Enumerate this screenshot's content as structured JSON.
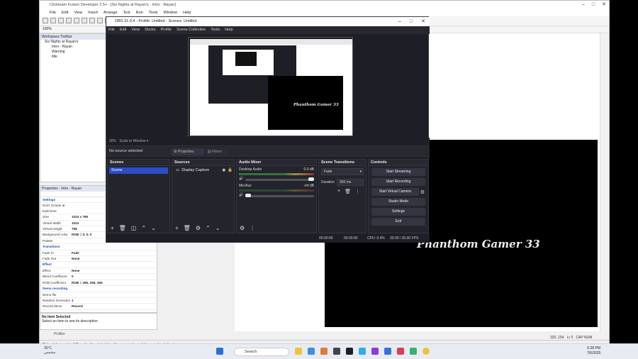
{
  "ctf": {
    "title": "Clickteam Fusion Developer 2.5+ - [Six Nights at Rayan's - Intro - Rayan]",
    "menu": [
      "File",
      "Edit",
      "View",
      "Insert",
      "Arrange",
      "Text",
      "Run",
      "Tools",
      "Window",
      "Help"
    ],
    "zoom": "100%",
    "workspace": {
      "title": "Workspace Toolbar",
      "tree": [
        "Six Nights at Rayan's",
        "Intro - Rayan",
        "Warning",
        "title"
      ]
    },
    "properties": {
      "title": "Properties - Intro - Rayan",
      "rows": [
        {
          "k": "Settings",
          "v": "",
          "sec": true
        },
        {
          "k": "Don't include at build time",
          "v": ""
        },
        {
          "k": "Size",
          "v": "1024 x 768"
        },
        {
          "k": "Virtual Width",
          "v": "1024"
        },
        {
          "k": "Virtual Height",
          "v": "768"
        },
        {
          "k": "Background color",
          "v": "RGB = 0, 0, 0"
        },
        {
          "k": "Palette",
          "v": ""
        },
        {
          "k": "Transitions",
          "v": "",
          "sec": true
        },
        {
          "k": "Fade In",
          "v": "Fade"
        },
        {
          "k": "Fade Out",
          "v": "None"
        },
        {
          "k": "Effect",
          "v": "",
          "sec": true
        },
        {
          "k": "Effect",
          "v": "None"
        },
        {
          "k": "Blend Coefficient",
          "v": "0"
        },
        {
          "k": "RGB Coefficient",
          "v": "RGB = 255, 255, 255"
        },
        {
          "k": "Demo recording",
          "v": "",
          "sec": true
        },
        {
          "k": "Demo file",
          "v": ""
        },
        {
          "k": "Random Generator",
          "v": "1"
        },
        {
          "k": "Record demo",
          "v": "Record"
        }
      ]
    },
    "no_item": {
      "title": "No Item Selected",
      "desc": "Select an item to see its description"
    },
    "profiler_tab": "Profiler",
    "status": "[1 item(s) remaining] Downloading data https://www.google-analytics.com/analytics.js...",
    "frame_text": "Phanthom Gamer 33",
    "coords": "320, 154",
    "coords2": "Lr 0",
    "caps": "CAP NUM"
  },
  "obs": {
    "title": "OBS 31.0.4 - Profile: Untitled - Scenes: Untitled",
    "menu": [
      "File",
      "Edit",
      "View",
      "Docks",
      "Profile",
      "Scene Collection",
      "Tools",
      "Help"
    ],
    "zoom_label": "30%",
    "scale_label": "Scale to Window",
    "no_source": "No source selected",
    "properties_btn": "Properties",
    "filters_btn": "Filters",
    "preview_text": "Phanthom Gamer 33",
    "scenes": {
      "title": "Scenes",
      "items": [
        "Scene"
      ]
    },
    "sources": {
      "title": "Sources",
      "items": [
        "Display Capture"
      ]
    },
    "mixer": {
      "title": "Audio Mixer",
      "channels": [
        {
          "name": "Desktop Audio",
          "db": "0.0 dB"
        },
        {
          "name": "Mic/Aux",
          "db": "-inf dB"
        }
      ]
    },
    "transitions": {
      "title": "Scene Transitions",
      "type": "Fade",
      "duration_label": "Duration",
      "duration": "300 ms"
    },
    "controls": {
      "title": "Controls",
      "buttons": [
        "Start Streaming",
        "Start Recording",
        "Start Virtual Camera",
        "Studio Mode",
        "Settings",
        "Exit"
      ]
    },
    "status": {
      "t1": "00:00:00",
      "t2": "00:00:00",
      "cpu": "CPU: 0.4%",
      "fps": "30.00 / 30.00 FPS"
    }
  },
  "taskbar": {
    "temp": "35°C",
    "weather": "مشمس",
    "search": "Search",
    "time": "6:28 PM",
    "date": "7/6/2025"
  }
}
